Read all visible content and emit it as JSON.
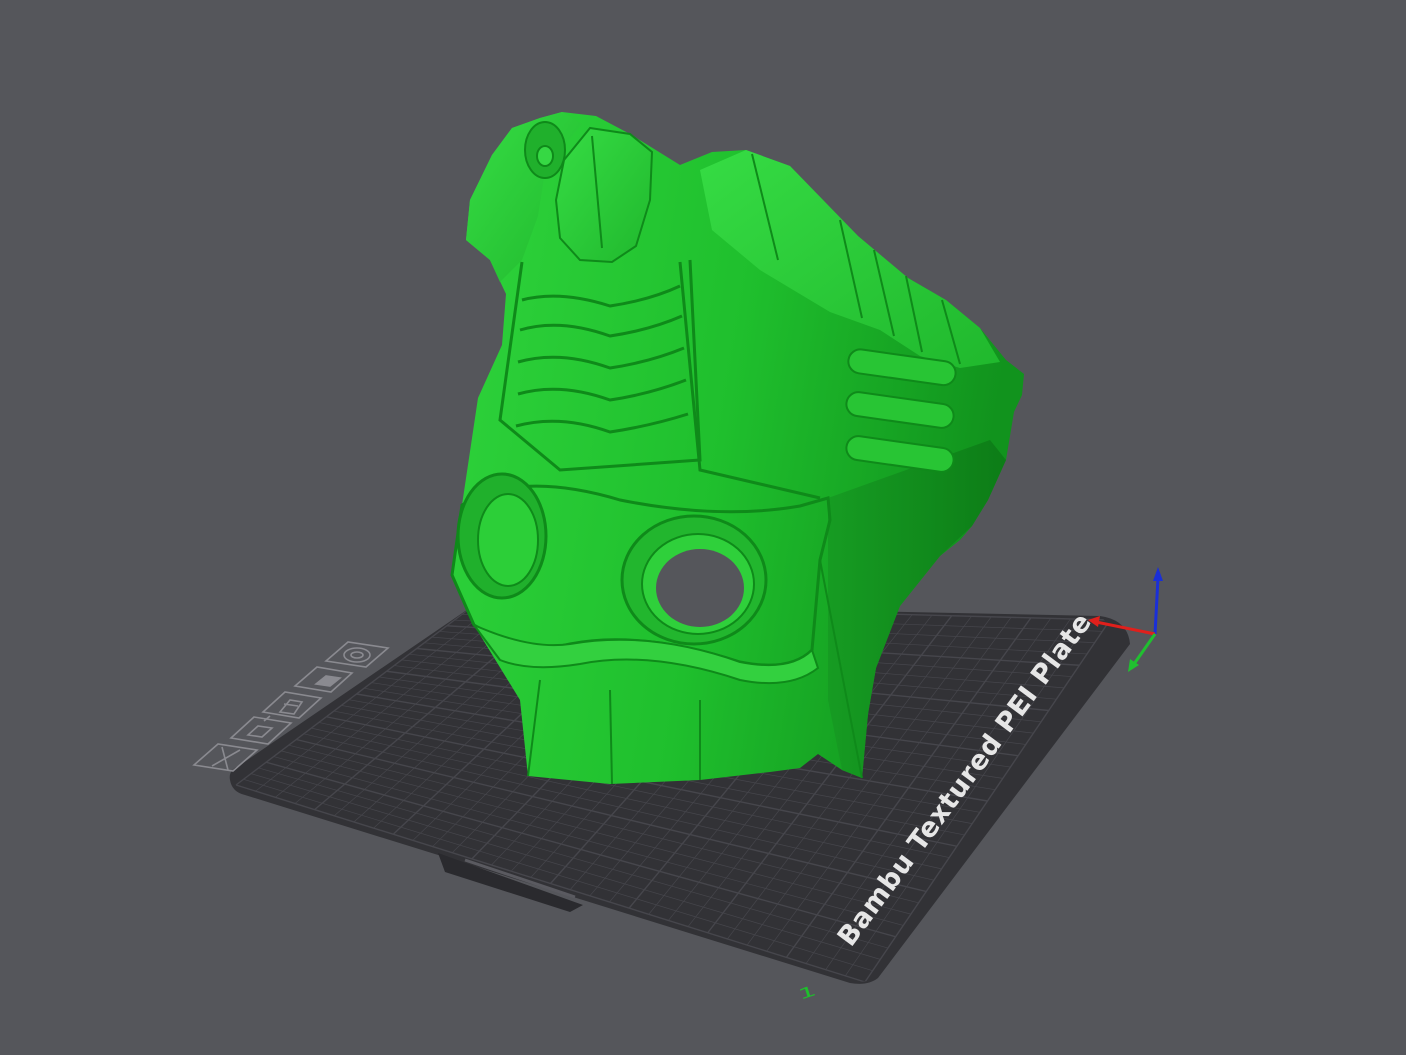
{
  "viewport": {
    "background_color": "#55565b",
    "model_color": "#1ab52a",
    "plate_color": "#323236",
    "grid_color": "#46464c"
  },
  "plate": {
    "label": "Bambu Textured PEI Plate",
    "number": "1"
  },
  "plate_toolbar": {
    "icons": [
      "close-plate-icon",
      "auto-arrange-icon",
      "orient-icon",
      "lock-icon",
      "plate-settings-icon"
    ]
  },
  "axes": {
    "x_color": "#e0201c",
    "y_color": "#20c030",
    "z_color": "#1a2fd8"
  }
}
